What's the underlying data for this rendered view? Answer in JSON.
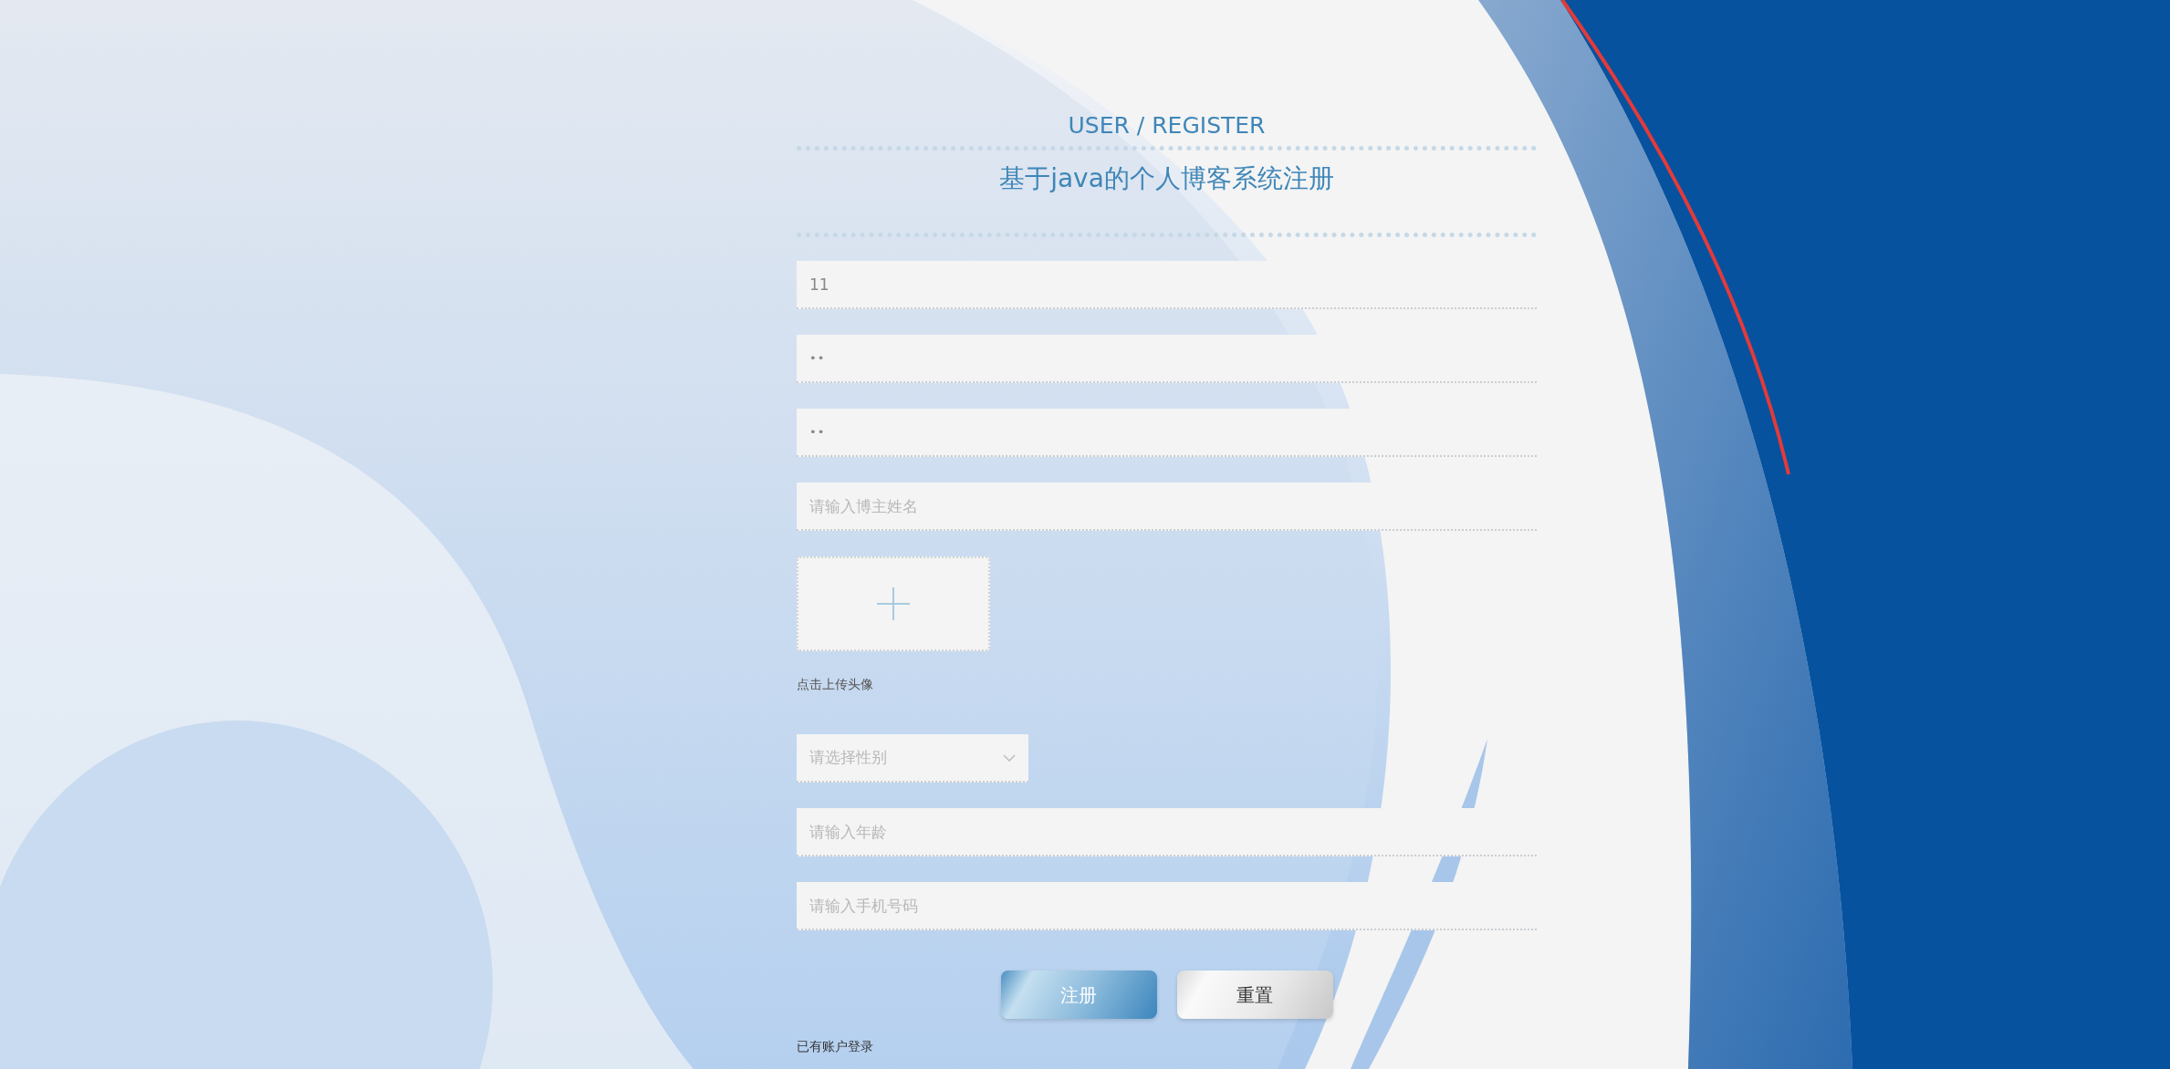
{
  "header": {
    "subtitle": "USER / REGISTER",
    "title": "基于java的个人博客系统注册"
  },
  "fields": [
    {
      "kind": "text",
      "value": "11"
    },
    {
      "kind": "password",
      "value": "••"
    },
    {
      "kind": "password",
      "value": "••"
    },
    {
      "kind": "text",
      "placeholder": "请输入博主姓名"
    }
  ],
  "avatar_upload": {
    "label": "点击上传头像"
  },
  "gender_select": {
    "placeholder": "请选择性别"
  },
  "more_fields": [
    {
      "kind": "text",
      "placeholder": "请输入年龄"
    },
    {
      "kind": "text",
      "placeholder": "请输入手机号码"
    }
  ],
  "buttons": [
    {
      "kind": "primary",
      "label": "注册"
    },
    {
      "kind": "secondary",
      "label": "重置"
    }
  ],
  "login_link": "已有账户登录"
}
